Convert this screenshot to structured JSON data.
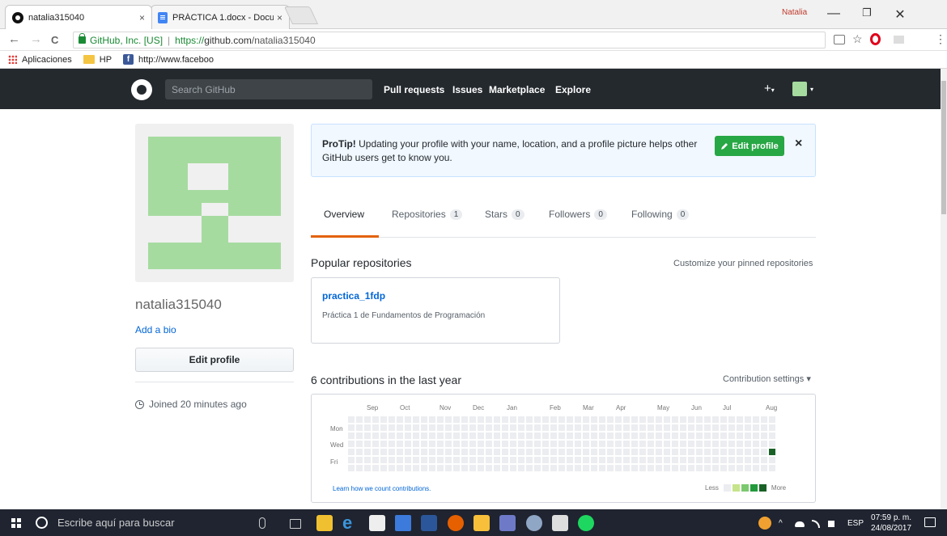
{
  "browser": {
    "tabs": [
      {
        "title": "natalia315040",
        "close": "×"
      },
      {
        "title": "PRÁCTICA 1.docx - Docu",
        "close": "×"
      }
    ],
    "profile_name": "Natalia",
    "window_buttons": {
      "minimize": "—",
      "maximize": "❐",
      "close": "✕"
    },
    "nav": {
      "back": "←",
      "forward": "→",
      "reload": "C"
    },
    "address": {
      "secure_label": "GitHub, Inc. [US]",
      "separator": "|",
      "scheme": "https://",
      "host": "github.com",
      "path": "/natalia315040"
    },
    "star": "☆",
    "menu": "⋮",
    "bookmarks": [
      {
        "label": "Aplicaciones",
        "icon": "apps-grid-icon"
      },
      {
        "label": "HP",
        "icon": "folder-icon"
      },
      {
        "label": "http://www.faceboo",
        "icon": "facebook-icon"
      }
    ]
  },
  "github": {
    "search_placeholder": "Search GitHub",
    "nav": [
      "Pull requests",
      "Issues",
      "Marketplace",
      "Explore"
    ],
    "plus": "+",
    "caret": "▾"
  },
  "profile": {
    "username": "natalia315040",
    "add_bio": "Add a bio",
    "edit_profile": "Edit profile",
    "joined": "Joined 20 minutes ago"
  },
  "protip": {
    "bold": "ProTip!",
    "text": " Updating your profile with your name, location, and a profile picture helps other GitHub users get to know you.",
    "button": "Edit profile",
    "close": "×"
  },
  "tabs": [
    {
      "label": "Overview",
      "count": null
    },
    {
      "label": "Repositories",
      "count": "1"
    },
    {
      "label": "Stars",
      "count": "0"
    },
    {
      "label": "Followers",
      "count": "0"
    },
    {
      "label": "Following",
      "count": "0"
    }
  ],
  "popular": {
    "heading": "Popular repositories",
    "customize": "Customize your pinned repositories",
    "repo_name": "practica_1fdp",
    "repo_desc": "Práctica 1 de Fundamentos de Programación"
  },
  "contributions": {
    "heading": "6 contributions in the last year",
    "settings": "Contribution settings ▾",
    "months": [
      "Sep",
      "Oct",
      "Nov",
      "Dec",
      "Jan",
      "Feb",
      "Mar",
      "Apr",
      "May",
      "Jun",
      "Jul",
      "Aug"
    ],
    "days": [
      "Mon",
      "Wed",
      "Fri"
    ],
    "learn": "Learn how we count contributions.",
    "less": "Less",
    "more": "More",
    "weeks": 53,
    "active_week": 52,
    "active_day": 4,
    "colors": [
      "#ebedf0",
      "#c6e48b",
      "#7bc96f",
      "#239a3b",
      "#196127"
    ]
  },
  "taskbar": {
    "search": "Escribe aquí para buscar",
    "time": "07:59 p. m.",
    "date": "24/08/2017",
    "lang": "ESP",
    "arrow": "^"
  },
  "colors": {
    "github_header": "#24292e",
    "link": "#0366d6",
    "green_button": "#28a745",
    "tab_accent": "#e36209",
    "identicon": "#a6dba0"
  }
}
